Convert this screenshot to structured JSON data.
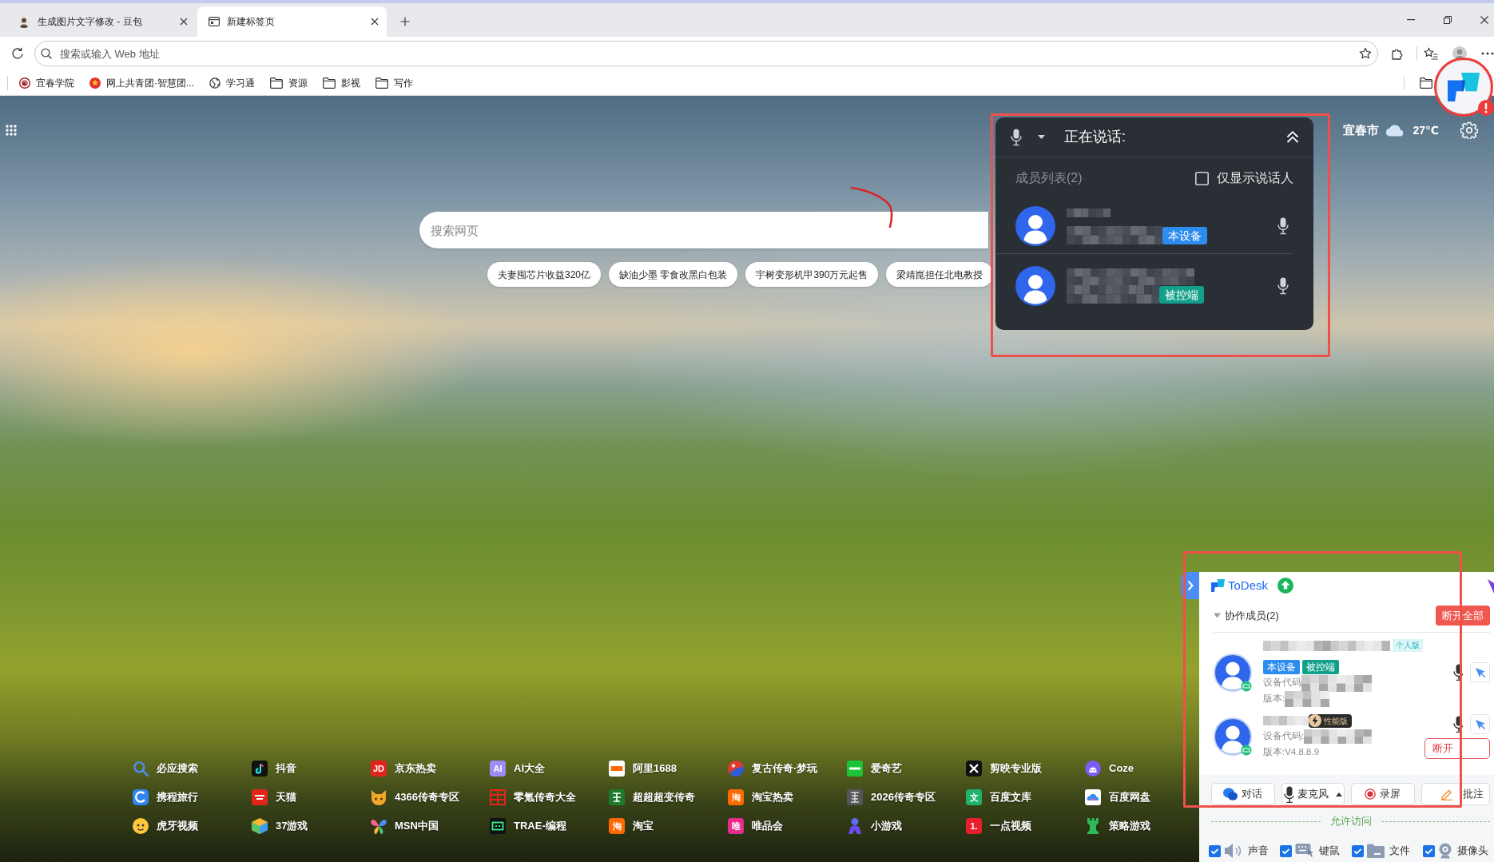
{
  "browser": {
    "tabs": [
      {
        "title": "生成图片文字修改 - 豆包",
        "selected": false
      },
      {
        "title": "新建标签页",
        "selected": true
      }
    ],
    "address_bar": {
      "placeholder": "搜索或输入 Web 地址"
    },
    "bookmarks": [
      {
        "label": "宜春学院",
        "kind": "site"
      },
      {
        "label": "网上共青团·智慧团...",
        "kind": "site"
      },
      {
        "label": "学习通",
        "kind": "site"
      },
      {
        "label": "资源",
        "kind": "folder"
      },
      {
        "label": "影视",
        "kind": "folder"
      },
      {
        "label": "写作",
        "kind": "folder"
      }
    ]
  },
  "new_tab": {
    "weather": {
      "city": "宜春市",
      "temperature": "27℃"
    },
    "search": {
      "placeholder": "搜索网页"
    },
    "trending": [
      "夫妻囤芯片收益320亿",
      "缺油少墨 零食改黑白包装",
      "宇树变形机甲390万元起售",
      "梁靖崑担任北电教授"
    ],
    "quick_links": [
      {
        "label": "必应搜索"
      },
      {
        "label": "抖音"
      },
      {
        "label": "京东热卖",
        "icon_text": "JD"
      },
      {
        "label": "AI大全",
        "icon_text": "AI"
      },
      {
        "label": "阿里1688"
      },
      {
        "label": "复古传奇·梦玩"
      },
      {
        "label": "爱奇艺"
      },
      {
        "label": "剪映专业版"
      },
      {
        "label": "Coze"
      },
      {
        "label": "携程旅行"
      },
      {
        "label": "天猫"
      },
      {
        "label": "4366传奇专区"
      },
      {
        "label": "零氪传奇大全"
      },
      {
        "label": "超超超变传奇"
      },
      {
        "label": "淘宝热卖",
        "icon_text": "淘"
      },
      {
        "label": "2026传奇专区"
      },
      {
        "label": "百度文库",
        "icon_text": "文"
      },
      {
        "label": "百度网盘"
      },
      {
        "label": "虎牙视频"
      },
      {
        "label": "37游戏"
      },
      {
        "label": "MSN中国"
      },
      {
        "label": "TRAE-编程"
      },
      {
        "label": "淘宝",
        "icon_text": "淘"
      },
      {
        "label": "唯品会",
        "icon_text": "唯"
      },
      {
        "label": "小游戏"
      },
      {
        "label": "一点视频",
        "icon_text": "1."
      },
      {
        "label": "策略游戏"
      }
    ]
  },
  "voice_panel": {
    "title": "正在说话:",
    "members_label": "成员列表(2)",
    "speakers_only": {
      "label": "仅显示说话人",
      "checked": false
    },
    "members": [
      {
        "name_hidden": true,
        "tag": {
          "label": "本设备",
          "kind": "self"
        }
      },
      {
        "name_hidden": true,
        "tag": {
          "label": "被控端",
          "kind": "controlled"
        }
      }
    ]
  },
  "todesk": {
    "brand": "ToDesk",
    "section": {
      "title": "协作成员(2)",
      "expanded": true
    },
    "disconnect_all": "断开全部",
    "members": [
      {
        "name_hidden": true,
        "edition": {
          "label": "个人版",
          "kind": "personal"
        },
        "tags": [
          {
            "label": "本设备",
            "kind": "self"
          },
          {
            "label": "被控端",
            "kind": "controlled"
          }
        ],
        "device_code": "设备代码",
        "code_hidden": true,
        "version": "版本:",
        "version_hidden": true
      },
      {
        "name_hidden": true,
        "edition": {
          "label": "性能版",
          "kind": "performance"
        },
        "device_code": "设备代码:",
        "code_hidden": true,
        "version": "版本:V4.8.8.9",
        "version_hidden": false,
        "disconnect": "断开"
      }
    ],
    "actions": [
      {
        "label": "对话",
        "kind": "chat"
      },
      {
        "label": "麦克风",
        "kind": "mic"
      },
      {
        "label": "录屏",
        "kind": "record"
      },
      {
        "label": "批注",
        "kind": "annotate"
      }
    ],
    "permissions_title": "允许访问",
    "permissions": [
      {
        "label": "声音",
        "kind": "sound",
        "checked": true
      },
      {
        "label": "键鼠",
        "kind": "input",
        "checked": true
      },
      {
        "label": "文件",
        "kind": "file",
        "checked": true
      },
      {
        "label": "摄像头",
        "kind": "camera",
        "checked": true
      }
    ]
  }
}
